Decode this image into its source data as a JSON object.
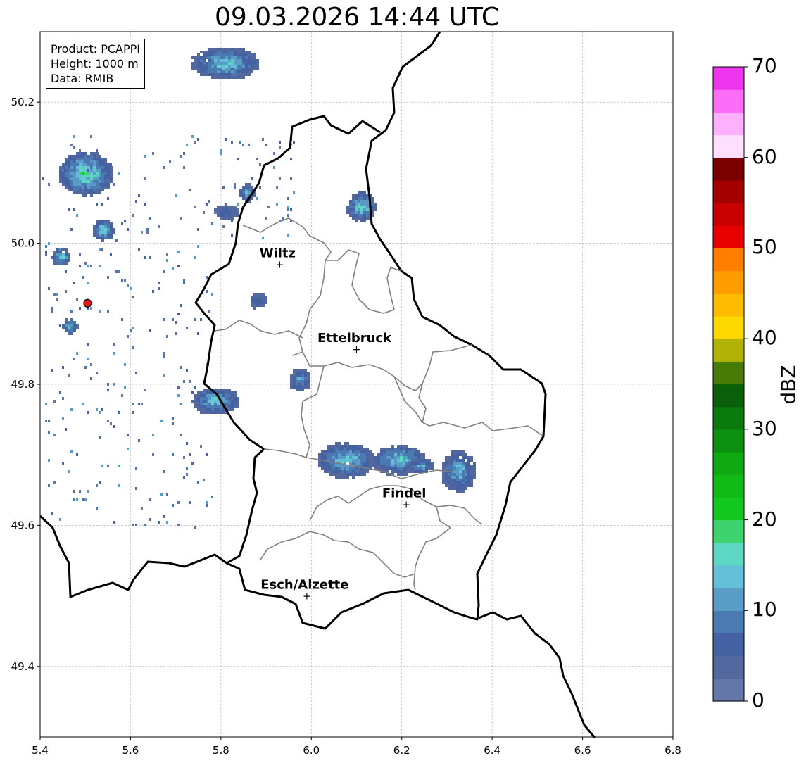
{
  "title": "09.03.2026 14:44 UTC",
  "info": {
    "product": "Product: PCAPPI",
    "height": "Height: 1000 m",
    "data": "Data: RMIB"
  },
  "axes": {
    "x_ticks": [
      "5.4",
      "5.6",
      "5.8",
      "6.0",
      "6.2",
      "6.4",
      "6.6",
      "6.8"
    ],
    "y_ticks": [
      "50.2",
      "50.0",
      "49.8",
      "49.6",
      "49.4"
    ],
    "x_range": [
      5.4,
      6.8
    ],
    "y_range": [
      49.3,
      50.3
    ]
  },
  "cities": [
    {
      "name": "Wiltz",
      "lon": 5.93,
      "lat": 49.97
    },
    {
      "name": "Ettelbruck",
      "lon": 6.1,
      "lat": 49.85
    },
    {
      "name": "Findel",
      "lon": 6.21,
      "lat": 49.63
    },
    {
      "name": "Esch/Alzette",
      "lon": 5.99,
      "lat": 49.5
    }
  ],
  "radar_site": {
    "lon": 5.505,
    "lat": 49.915,
    "color": "#e31a1c"
  },
  "colorbar": {
    "label": "dBZ",
    "ticks": [
      "0",
      "10",
      "20",
      "30",
      "40",
      "50",
      "60",
      "70"
    ],
    "colors": [
      "#6577a8",
      "#5468a0",
      "#4461a2",
      "#4b79b1",
      "#599cc6",
      "#63c0d8",
      "#5ed8c4",
      "#3ed36e",
      "#12c81f",
      "#12ba16",
      "#10a812",
      "#0d8f0f",
      "#0b7a0c",
      "#095f0a",
      "#477a07",
      "#b0b208",
      "#ffd800",
      "#ffbb00",
      "#ff9d00",
      "#ff7e00",
      "#e60000",
      "#c90000",
      "#a30000",
      "#7a0000",
      "#fedffe",
      "#fdb0fd",
      "#fc6ef7",
      "#ef36ef"
    ]
  },
  "colors": {
    "border": "#000000",
    "cantons": "#808080",
    "grid": "#b0b0b0"
  }
}
